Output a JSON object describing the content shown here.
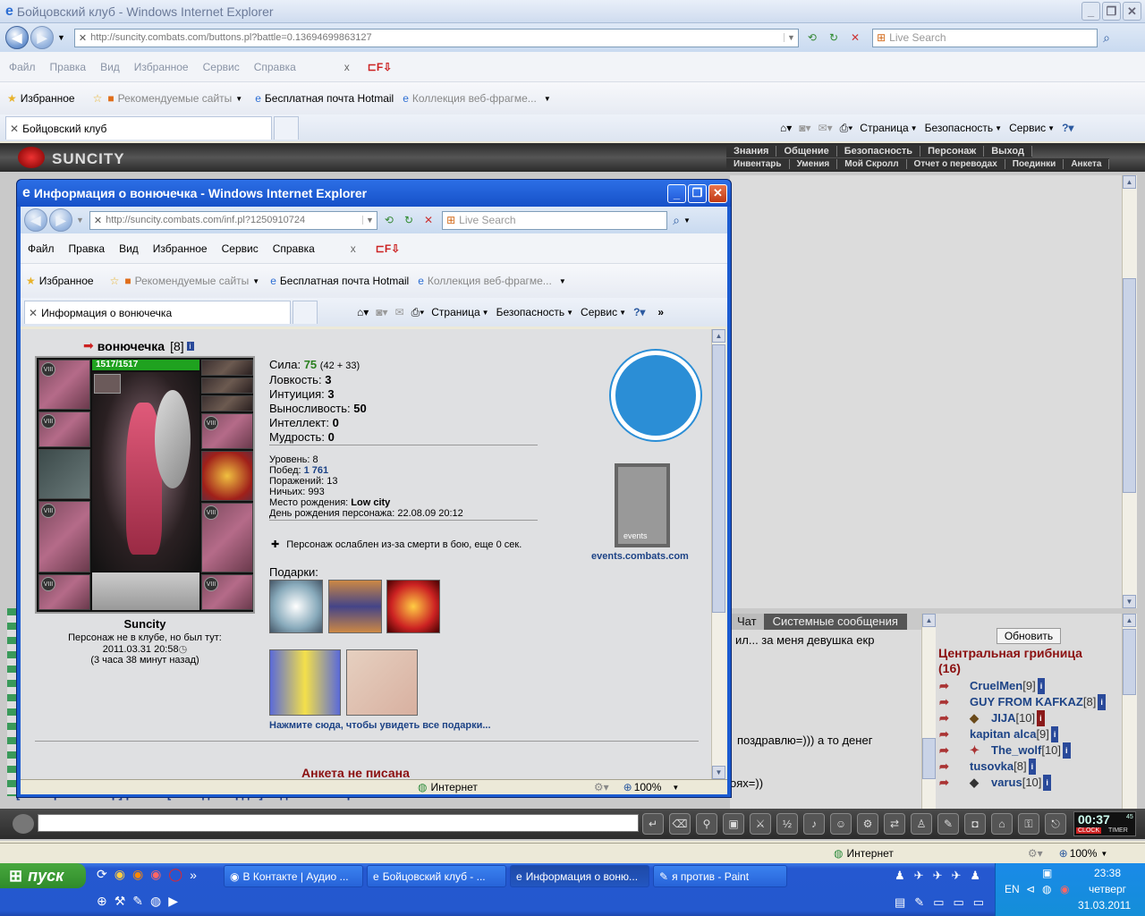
{
  "main_window": {
    "title": "Бойцовский клуб - Windows Internet Explorer",
    "address": "http://suncity.combats.com/buttons.pl?battle=0.13694699863127",
    "search_placeholder": "Live Search",
    "menu": [
      "Файл",
      "Правка",
      "Вид",
      "Избранное",
      "Сервис",
      "Справка"
    ],
    "favorites_label": "Избранное",
    "fav_links": [
      "Рекомендуемые сайты",
      "Бесплатная почта Hotmail",
      "Коллекция веб-фрагме..."
    ],
    "tab_title": "Бойцовский клуб",
    "cmd": [
      "Страница",
      "Безопасность",
      "Сервис"
    ],
    "status_zone": "Интернет",
    "zoom": "100%"
  },
  "game": {
    "logo": "SUNCITY",
    "menu_top": [
      "Знания",
      "Общение",
      "Безопасность",
      "Персонаж",
      "Выход"
    ],
    "menu_bottom": [
      "Инвентарь",
      "Умения",
      "Мой Скролл",
      "Отчет о переводах",
      "Поединки",
      "Анкета"
    ],
    "chat_tabs": [
      "Чат",
      "Системные сообщения"
    ],
    "chat_lines": [
      "ил... за меня девушка екр",
      "поздравлю=))) а то денег",
      "оях=))"
    ],
    "chat_bottom_line": "[мастер ломастер] private [ володя морда ] а где твой зверь?",
    "refresh_label": "Обновить",
    "location_title": "Центральная грибница",
    "location_count": "(16)",
    "users": [
      {
        "name": "CruelMen",
        "level": "[9]"
      },
      {
        "name": "GUY FROM KAFKAZ",
        "level": "[8]"
      },
      {
        "name": "JIJA",
        "level": "[10]"
      },
      {
        "name": "kapitan alca",
        "level": "[9]"
      },
      {
        "name": "The_wolf",
        "level": "[10]"
      },
      {
        "name": "tusovka",
        "level": "[8]"
      },
      {
        "name": "varus",
        "level": "[10]"
      }
    ],
    "clock": "00:37",
    "clock_sub": "45",
    "clock_labels": [
      "CLOCK",
      "TIMER"
    ]
  },
  "popup": {
    "title": "Информация о вонючечка - Windows Internet Explorer",
    "address": "http://suncity.combats.com/inf.pl?1250910724",
    "search_placeholder": "Live Search",
    "menu": [
      "Файл",
      "Правка",
      "Вид",
      "Избранное",
      "Сервис",
      "Справка"
    ],
    "favorites_label": "Избранное",
    "fav_links": [
      "Рекомендуемые сайты",
      "Бесплатная почта Hotmail",
      "Коллекция веб-фрагме..."
    ],
    "tab_title": "Информация о вонючечка",
    "cmd": [
      "Страница",
      "Безопасность",
      "Сервис"
    ],
    "status_zone": "Интернет",
    "zoom": "100%"
  },
  "character": {
    "name": "вонючечка",
    "level": "[8]",
    "hp": "1517/1517",
    "hp_fraction": 1.0,
    "city": "Suncity",
    "not_in_club": "Персонаж не в клубе, но был тут:",
    "last_seen": "2011.03.31 20:58",
    "ago": "(3 часа 38 минут назад)",
    "stats": [
      {
        "label": "Сила:",
        "value": "75",
        "extra": "(42 + 33)"
      },
      {
        "label": "Ловкость:",
        "value": "3",
        "extra": ""
      },
      {
        "label": "Интуиция:",
        "value": "3",
        "extra": ""
      },
      {
        "label": "Выносливость:",
        "value": "50",
        "extra": ""
      },
      {
        "label": "Интеллект:",
        "value": "0",
        "extra": ""
      },
      {
        "label": "Мудрость:",
        "value": "0",
        "extra": ""
      }
    ],
    "info": [
      {
        "label": "Уровень:",
        "value": "8"
      },
      {
        "label": "Побед:",
        "value": "1 761"
      },
      {
        "label": "Поражений:",
        "value": "13"
      },
      {
        "label": "Ничьих:",
        "value": "993"
      },
      {
        "label": "Место рождения:",
        "value": "Low city"
      },
      {
        "label": "День рождения персонажа:",
        "value": "22.08.09 20:12"
      }
    ],
    "weakened": "Персонаж ослаблен из-за смерти в бою, еще 0 сек.",
    "gifts_label": "Подарки:",
    "gifts_link": "Нажмите сюда, чтобы увидеть все подарки...",
    "events_badge": "events",
    "events_link": "events.combats.com",
    "bottom_heading": "Анкета не писана"
  },
  "taskbar": {
    "start": "пуск",
    "buttons": [
      "В Контакте | Аудио ...",
      "Бойцовский клуб - ...",
      "Информация о воню...",
      "я против - Paint"
    ],
    "lang": "EN",
    "time": "23:38",
    "day": "четверг",
    "date": "31.03.2011"
  },
  "colors": {
    "xp_blue": "#1b5bd1",
    "hp_green": "#1fa21f",
    "stat_green": "#2a7f1f",
    "link_blue": "#1d4386",
    "location_red": "#8b1010"
  }
}
